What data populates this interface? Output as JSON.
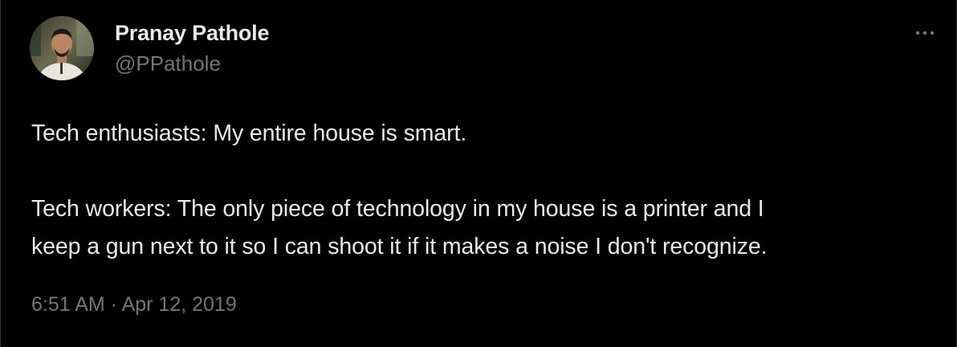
{
  "tweet": {
    "author": {
      "name": "Pranay Pathole",
      "handle": "@PPathole",
      "avatar_icon": "profile-photo"
    },
    "more_icon": "more-horizontal-icon",
    "text_lines": [
      "Tech enthusiasts: My entire house is smart.",
      "Tech workers: The only piece of technology in my house is a printer and I",
      "keep a gun next to it so I can shoot it if it makes a noise I don't recognize."
    ],
    "time": "6:51 AM",
    "separator": "·",
    "date": "Apr 12, 2019"
  },
  "colors": {
    "background": "#000000",
    "primary_text": "#e7e9ea",
    "secondary_text": "#71767b"
  }
}
